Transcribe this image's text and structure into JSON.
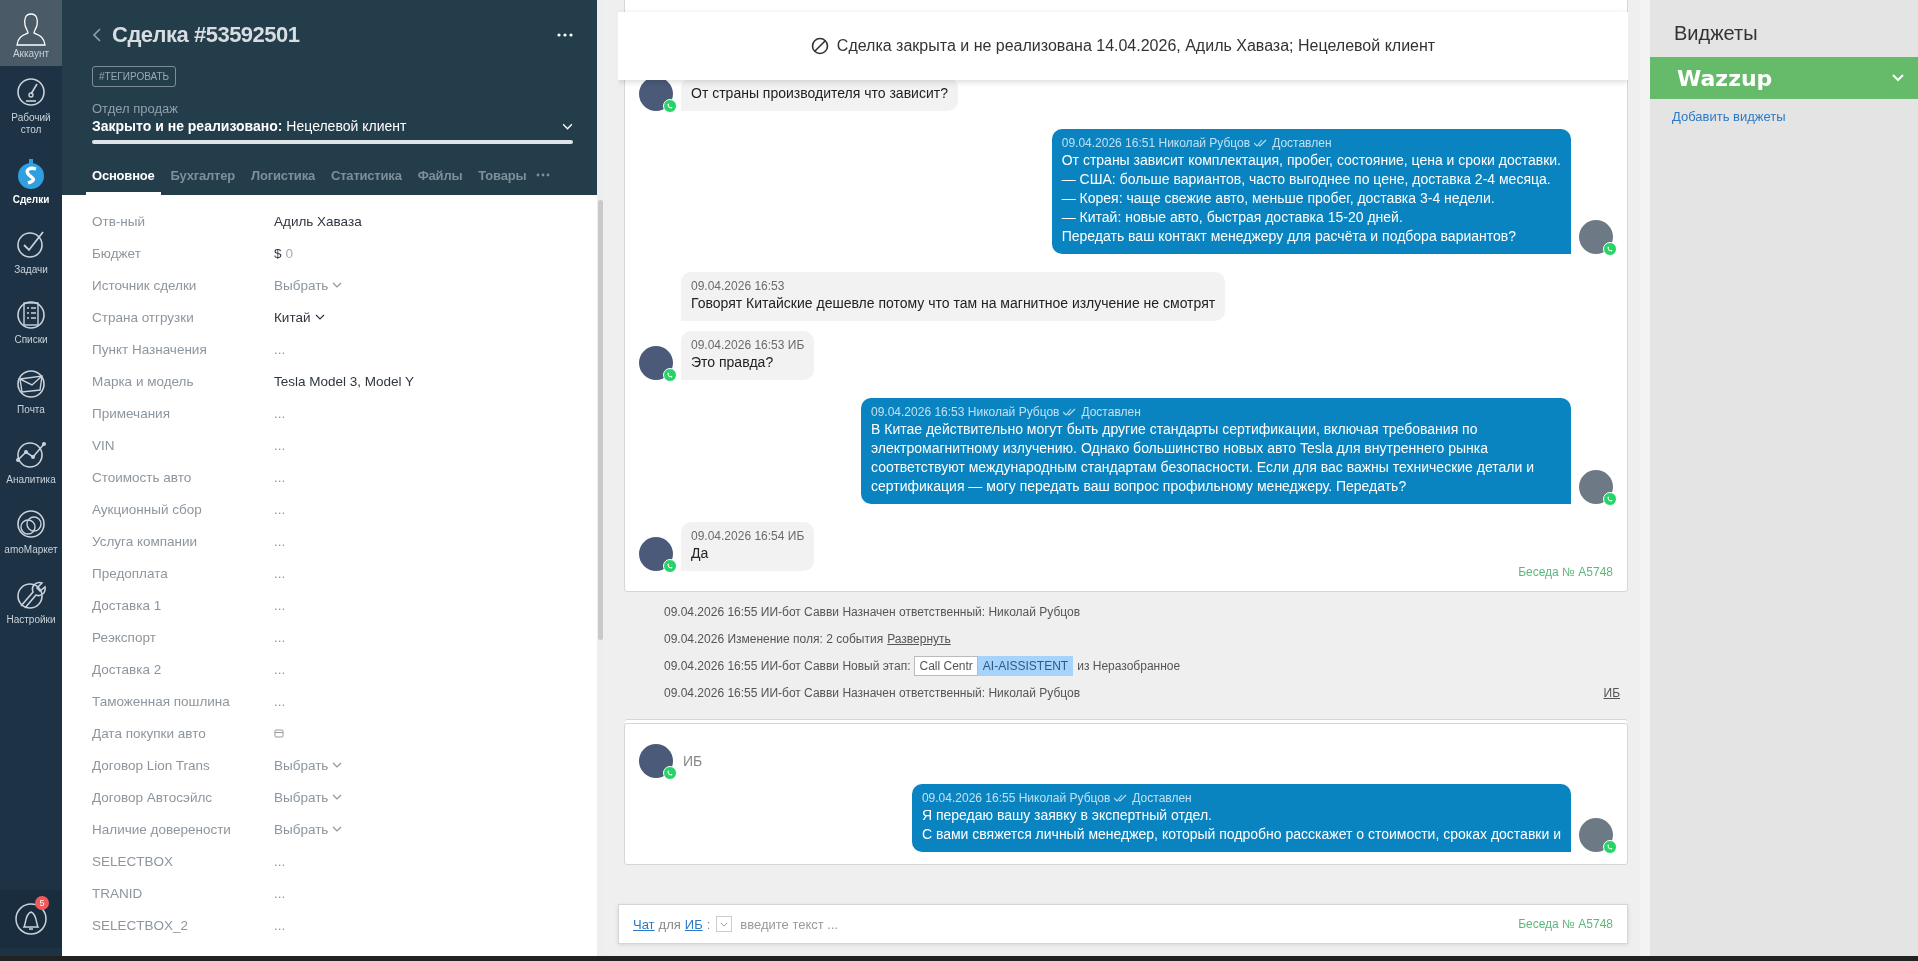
{
  "nav": {
    "account": {
      "label": "Аккаунт"
    },
    "items": [
      {
        "kind": "dashboard",
        "label": "Рабочий стол",
        "selected": false
      },
      {
        "kind": "deals",
        "label": "Сделки",
        "selected": true
      },
      {
        "kind": "tasks",
        "label": "Задачи",
        "selected": false
      },
      {
        "kind": "lists",
        "label": "Списки",
        "selected": false
      },
      {
        "kind": "mail",
        "label": "Почта",
        "selected": false
      },
      {
        "kind": "analytics",
        "label": "Аналитика",
        "selected": false
      },
      {
        "kind": "market",
        "label": "amoМаркет",
        "selected": false
      },
      {
        "kind": "settings",
        "label": "Настройки",
        "selected": false
      }
    ],
    "notifications": {
      "badge": "5"
    }
  },
  "deal": {
    "title": "Сделка #53592501",
    "tag_button": "#ТЕГИРОВАТЬ",
    "pipeline": "Отдел продаж",
    "status": "**Закрыто и не реализовано:** Нецелевой клиент",
    "tabs": [
      {
        "label": "Основное",
        "selected": true
      },
      {
        "label": "Бухгалтер",
        "selected": false
      },
      {
        "label": "Логистика",
        "selected": false
      },
      {
        "label": "Статистика",
        "selected": false
      },
      {
        "label": "Файлы",
        "selected": false
      },
      {
        "label": "Товары",
        "selected": false
      }
    ],
    "fields": [
      {
        "label": "Отв-ный",
        "kind": "text",
        "value": "Адиль Хаваза"
      },
      {
        "label": "Бюджет",
        "kind": "money",
        "currency": "$",
        "placeholder": "0"
      },
      {
        "label": "Источник сделки",
        "kind": "select",
        "placeholder": "Выбрать"
      },
      {
        "label": "Страна отгрузки",
        "kind": "select",
        "value": "Китай"
      },
      {
        "label": "Пункт Назначения",
        "kind": "empty",
        "placeholder": "..."
      },
      {
        "label": "Марка и модель",
        "kind": "text",
        "value": "Tesla Model 3, Model Y"
      },
      {
        "label": "Примечания",
        "kind": "empty",
        "placeholder": "..."
      },
      {
        "label": "VIN",
        "kind": "empty",
        "placeholder": "..."
      },
      {
        "label": "Стоимость авто",
        "kind": "empty",
        "placeholder": "..."
      },
      {
        "label": "Аукционный сбор",
        "kind": "empty",
        "placeholder": "..."
      },
      {
        "label": "Услуга компании",
        "kind": "empty",
        "placeholder": "..."
      },
      {
        "label": "Предоплата",
        "kind": "empty",
        "placeholder": "..."
      },
      {
        "label": "Доставка 1",
        "kind": "empty",
        "placeholder": "..."
      },
      {
        "label": "Реэкспорт",
        "kind": "empty",
        "placeholder": "..."
      },
      {
        "label": "Доставка 2",
        "kind": "empty",
        "placeholder": "..."
      },
      {
        "label": "Таможенная пошлина",
        "kind": "empty",
        "placeholder": "..."
      },
      {
        "label": "Дата покупки авто",
        "kind": "date"
      },
      {
        "label": "Договор Lion Trans",
        "kind": "select",
        "placeholder": "Выбрать"
      },
      {
        "label": "Договор Автосэйлс",
        "kind": "select",
        "placeholder": "Выбрать"
      },
      {
        "label": "Наличие доверености",
        "kind": "select",
        "placeholder": "Выбрать"
      },
      {
        "label": "SELECTBOX",
        "kind": "empty",
        "placeholder": "..."
      },
      {
        "label": "TRANID",
        "kind": "empty",
        "placeholder": "..."
      },
      {
        "label": "SELECTBOX_2",
        "kind": "empty",
        "placeholder": "..."
      }
    ]
  },
  "chat": {
    "banner": "Сделка закрыта и не реализована 14.04.2026, Адиль Хаваза; Нецелевой клиент",
    "card_1": {
      "messages": [
        {
          "kind": "incoming",
          "avatar": true,
          "text": "От страны производителя что зависит?"
        },
        {
          "kind": "outgoing",
          "avatar": true,
          "meta": {
            "date": "09.04.2026 16:51",
            "author": "Николай Рубцов",
            "status": "Доставлен"
          },
          "text": "От страны зависит комплектация, пробег, состояние, цена и сроки доставки.\n— США: больше вариантов, часто выгоднее по цене, доставка 2-4 месяца.\n— Корея: чаще свежие авто, меньше пробег, доставка 3-4 недели.\n— Китай: новые авто, быстрая доставка 15-20 дней.\nПередать ваш контакт менеджеру для расчёта и подбора вариантов?"
        },
        {
          "kind": "incoming",
          "avatar": false,
          "meta": {
            "date": "09.04.2026 16:53"
          },
          "text": "Говорят Китайские дешевле потому что там на магнитное излучение не смотрят"
        },
        {
          "kind": "incoming",
          "avatar": true,
          "meta": {
            "date": "09.04.2026 16:53 ИБ"
          },
          "text": "Это правда?"
        },
        {
          "kind": "outgoing",
          "avatar": true,
          "meta": {
            "date": "09.04.2026 16:53",
            "author": "Николай Рубцов",
            "status": "Доставлен"
          },
          "text": "В Китае действительно могут быть другие стандарты сертификации, включая требования по электромагнитному излучению. Однако большинство новых авто Tesla для внутреннего рынка соответствуют международным стандартам безопасности. Если для вас важны технические детали и сертификация — могу передать ваш вопрос профильному менеджеру. Передать?"
        },
        {
          "kind": "incoming",
          "avatar": true,
          "meta": {
            "date": "09.04.2026 16:54 ИБ"
          },
          "text": "Да"
        }
      ],
      "conversation": "Беседа № A5748"
    },
    "events": [
      {
        "kind": "plain",
        "text": "09.04.2026 16:55 ИИ-бот Савви Назначен ответственный: Николай Рубцов"
      },
      {
        "kind": "link",
        "text": "09.04.2026 Изменение поля: 2 события",
        "link": "Развернуть"
      },
      {
        "kind": "stage",
        "text": "09.04.2026 16:55 ИИ-бот Савви Новый этап:",
        "stages": [
          "Call Centr",
          "AI-AISSISTENT"
        ],
        "after": "из Неразобранное"
      },
      {
        "kind": "plain",
        "text": "09.04.2026 16:55 ИИ-бот Савви Назначен ответственный: Николай Рубцов",
        "aside": "ИБ"
      }
    ],
    "card_2": {
      "contact": "ИБ",
      "messages": [
        {
          "kind": "outgoing",
          "avatar": true,
          "meta": {
            "date": "09.04.2026 16:55",
            "author": "Николай Рубцов",
            "status": "Доставлен"
          },
          "text": "Я передаю вашу заявку в экспертный отдел.\nС вами свяжется личный менеджер, который подробно расскажет о стоимости, сроках доставки и"
        }
      ]
    },
    "input": {
      "chat_link": "Чат",
      "for": "для",
      "contact_link": "ИБ",
      "colon": ":",
      "placeholder": "введите текст ...",
      "conversation": "Беседа № A5748"
    }
  },
  "widgets": {
    "title": "Виджеты",
    "items": [
      {
        "label": "Wazzup",
        "color": "#66bb6a"
      }
    ],
    "add_link": "Добавить виджеты"
  }
}
